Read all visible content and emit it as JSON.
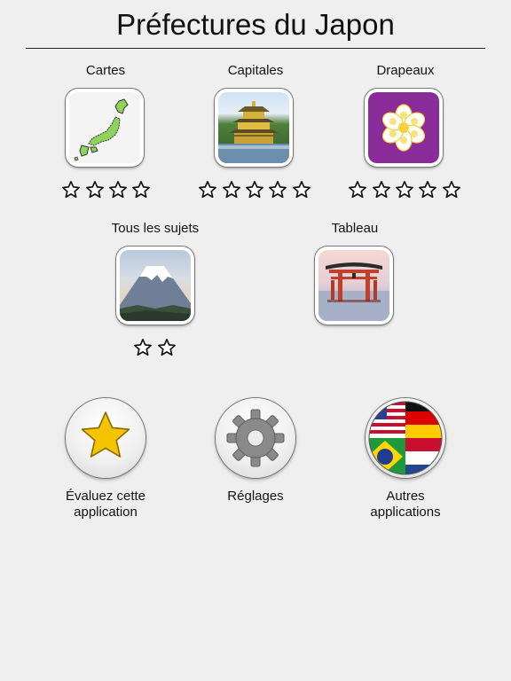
{
  "header": {
    "title": "Préfectures du Japon"
  },
  "modes": [
    {
      "label": "Cartes",
      "icon": "japan-map-icon",
      "stars_total": 4,
      "stars_filled": 0
    },
    {
      "label": "Capitales",
      "icon": "golden-pavilion-photo",
      "stars_total": 5,
      "stars_filled": 0
    },
    {
      "label": "Drapeaux",
      "icon": "kyoto-flag-icon",
      "stars_total": 5,
      "stars_filled": 0
    },
    {
      "label": "Tous les sujets",
      "icon": "mount-fuji-photo",
      "stars_total": 2,
      "stars_filled": 0
    },
    {
      "label": "Tableau",
      "icon": "torii-gate-photo"
    }
  ],
  "actions": [
    {
      "label_line1": "Évaluez cette",
      "label_line2": "application",
      "icon": "star-icon"
    },
    {
      "label_line1": "Réglages",
      "icon": "gear-icon"
    },
    {
      "label_line1": "Autres",
      "label_line2": "applications",
      "icon": "flags-globe-icon"
    }
  ],
  "colors": {
    "flag_purple": "#8a2b9a",
    "star_gold": "#f5c400",
    "gear_gray": "#8a8a8a"
  }
}
